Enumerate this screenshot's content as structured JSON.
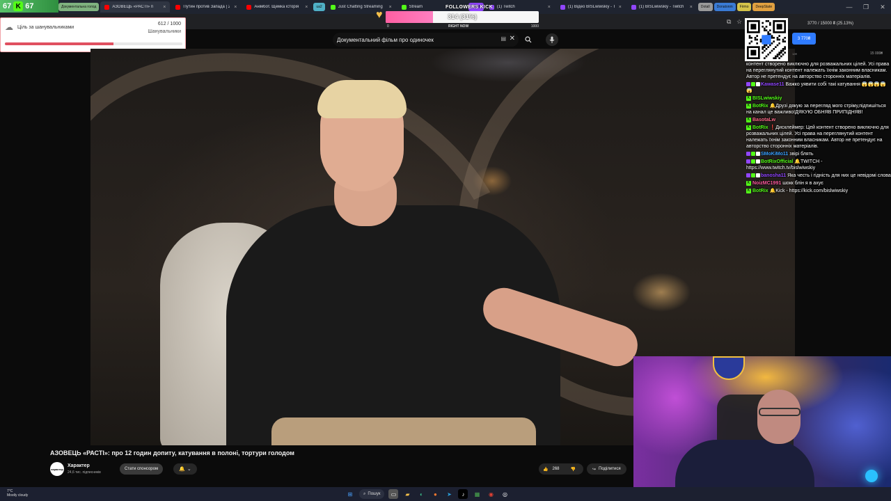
{
  "kick_counter": {
    "left_value": "67",
    "right_value": "67",
    "letter": "K"
  },
  "tabs": [
    {
      "label": "Документальна голод",
      "color": "#7fb27f",
      "pill": true
    },
    {
      "label": "АЗОВЕЦЬ «РАСТІ» п",
      "color": "#ff0000",
      "active": true
    },
    {
      "label": "Путин против Запада | 2",
      "color": "#ff0000"
    },
    {
      "label": "Анімбот. Щемка історія",
      "color": "#ff0000"
    },
    {
      "label": "ua2",
      "color": "#4fb0c6",
      "pill": true
    },
    {
      "label": "Just Chatting Streaming",
      "color": "#53fc18"
    },
    {
      "label": "Stream",
      "color": "#53fc18"
    },
    {
      "label": "Twitch",
      "color": "#9146ff",
      "pill": true
    },
    {
      "label": "(1) Twitch",
      "color": "#9146ff"
    },
    {
      "label": "(1) Відео BISLwiwskiy - Tw",
      "color": "#9146ff"
    },
    {
      "label": "(1) BISLwiwskiy - Twitch",
      "color": "#9146ff"
    },
    {
      "label": "Dotall",
      "color": "#9a9a9a",
      "pill": true
    },
    {
      "label": "Donatonm",
      "color": "#3a7bd5",
      "pill": true
    },
    {
      "label": "Firmo",
      "color": "#d4c34a",
      "pill": true
    },
    {
      "label": "DeepState",
      "color": "#e0a040",
      "pill": true
    }
  ],
  "followers_goal": {
    "title": "FOLLOWERS KICK",
    "value_text": "314 (31%)",
    "fraction": 0.31,
    "min": "0",
    "now_label": "RIGHT NOW",
    "max": "1000"
  },
  "supporter_goal": {
    "label": "Ціль за шанувальниками",
    "count": "612 / 1000",
    "sub": "Шанувальники",
    "fraction": 0.612
  },
  "search": {
    "query": "Документальний фільм  про одиночек"
  },
  "video": {
    "title": "АЗОВЕЦЬ «РАСТІ»: про 12 годин допиту, катування в полоні, тортури голодом",
    "channel": "Характер",
    "channel_avatar_text": "характер",
    "subscribers": "24,6 тис. підписників",
    "sponsor_label": "Стати спонсором",
    "likes": "268",
    "share_label": "Поділитися"
  },
  "donation_goal": {
    "text": "3770 / 15000 ₴ (25.13%)",
    "button": "3 770₴",
    "min": "12₴",
    "max": "15 000₴"
  },
  "chat": [
    {
      "nick": "",
      "text": "контент створено виключно для розважальних цілей. Усі права на переглянутий контент належать їхнім законним власникам. Автор не претендує на авторство сторонніх матеріалів.",
      "nick_color": "#ffffff"
    },
    {
      "nick": "Kawase11",
      "text": "Важко уявити собі такі катування 😱😱😱😱😱",
      "nick_color": "#9146ff",
      "platform": "twitch"
    },
    {
      "nick": "BISLwiwskiy",
      "text": "",
      "nick_color": "#53fc18",
      "platform": "kick"
    },
    {
      "nick": "BotRix",
      "text": "🔔Друзі дякую за перегляд мого стріму,підпишіться на канал це важливо!ДЯКУЮ ОБНЯВ ПРИПІДНЯВ!",
      "nick_color": "#53fc18",
      "platform": "kick"
    },
    {
      "nick": "BasotaLw",
      "text": "",
      "nick_color": "#ff6a8a",
      "platform": "kick"
    },
    {
      "nick": "BotRix",
      "text": "❗Дисклеймер: Цей контент створено виключно для розважальних цілей. Усі права на переглянутий контент належать їхнім законним власникам. Автор не претендує на авторство сторонніх матеріалів.",
      "nick_color": "#53fc18",
      "platform": "kick"
    },
    {
      "nick": "SMoKiMo11",
      "text": "звірі блять",
      "nick_color": "#3aa0ff",
      "platform": "twitch"
    },
    {
      "nick": "BotRixOfficial",
      "text": "🔔TWITCH - https://www.twitch.tv/bislwiwskiy",
      "nick_color": "#53fc18",
      "platform": "twitch"
    },
    {
      "nick": "banosha11",
      "text": "Яка честь і гідність для них це невідомі слова",
      "nick_color": "#9146ff",
      "platform": "twitch"
    },
    {
      "nick": "NoizMC1991",
      "text": "шокк блін я в ахує",
      "nick_color": "#ff5aa0",
      "platform": "kick"
    },
    {
      "nick": "BotRix",
      "text": "🔔Kick - https://kick.com/bislwiwskiy",
      "nick_color": "#53fc18",
      "platform": "kick"
    }
  ],
  "taskbar": {
    "weather_temp": "7°C",
    "weather_desc": "Mostly cloudy",
    "search_label": "Пошук"
  },
  "colors": {
    "accent_kick": "#53fc18",
    "accent_twitch": "#9146ff",
    "goal_pink": "#ff5fa2"
  }
}
